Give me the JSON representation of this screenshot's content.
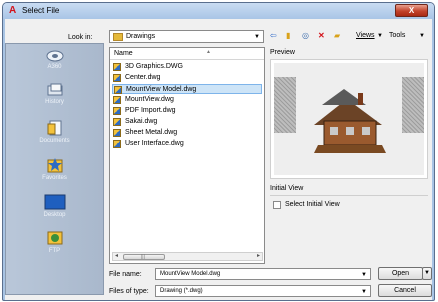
{
  "window": {
    "title": "Select File",
    "app_icon": "A",
    "close_label": "X"
  },
  "lookin": {
    "label": "Look in:",
    "value": "Drawings"
  },
  "toolbar": {
    "views_label": "Views",
    "tools_label": "Tools"
  },
  "places": [
    {
      "label": "A360",
      "icon": "a360-icon"
    },
    {
      "label": "History",
      "icon": "history-icon"
    },
    {
      "label": "Documents",
      "icon": "documents-icon"
    },
    {
      "label": "Favorites",
      "icon": "favorites-icon"
    },
    {
      "label": "Desktop",
      "icon": "desktop-icon"
    },
    {
      "label": "FTP",
      "icon": "ftp-icon"
    }
  ],
  "filelist": {
    "column_name": "Name",
    "files": [
      {
        "name": "3D Graphics.DWG"
      },
      {
        "name": "Center.dwg"
      },
      {
        "name": "MountView Model.dwg",
        "selected": true
      },
      {
        "name": "MountView.dwg"
      },
      {
        "name": "PDF Import.dwg"
      },
      {
        "name": "Sakai.dwg"
      },
      {
        "name": "Sheet Metal.dwg"
      },
      {
        "name": "User Interface.dwg"
      }
    ]
  },
  "preview": {
    "label": "Preview"
  },
  "initial_view": {
    "label": "Initial View",
    "checkbox_label": "Select Initial View",
    "checked": false
  },
  "filename": {
    "label": "File name:",
    "value": "MountView Model.dwg"
  },
  "filetype": {
    "label": "Files of type:",
    "value": "Drawing (*.dwg)"
  },
  "buttons": {
    "open": "Open",
    "cancel": "Cancel"
  },
  "colors": {
    "accent": "#cde4f7",
    "title_bar": "#a9c5e6",
    "close": "#c3432c",
    "sidebar": "#b0bfd2"
  }
}
